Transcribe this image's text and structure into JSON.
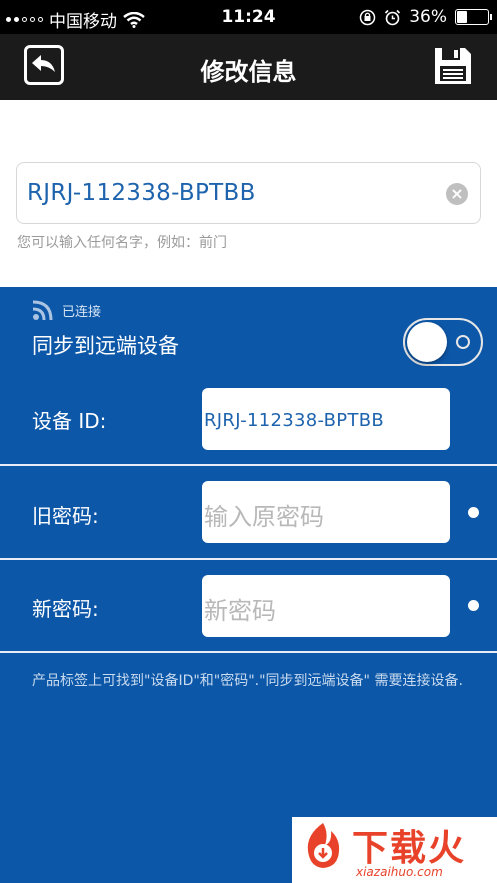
{
  "status_bar": {
    "carrier": "中国移动",
    "time": "11:24",
    "battery": "36%",
    "battery_level": 0.36
  },
  "nav": {
    "title": "修改信息"
  },
  "device_name": {
    "value": "RJRJ-112338-BPTBB",
    "hint": "您可以输入任何名字，例如：前门"
  },
  "panel": {
    "connection_status": "已连接",
    "sync_label": "同步到远端设备",
    "sync_enabled": false,
    "device_id_label": "设备 ID:",
    "device_id_value": "RJRJ-112338-BPTBB",
    "old_password_label": "旧密码:",
    "old_password_placeholder": "输入原密码",
    "new_password_label": "新密码:",
    "new_password_placeholder": "新密码",
    "note": "产品标签上可找到\"设备ID\"和\"密码\".\"同步到远端设备\" 需要连接设备."
  },
  "watermark": {
    "text": "下载火",
    "sub": "xiazaihuo.com"
  },
  "colors": {
    "panel_blue": "#0d57a8",
    "nav_dark": "#1b1b1b",
    "value_blue": "#1e63ad"
  }
}
